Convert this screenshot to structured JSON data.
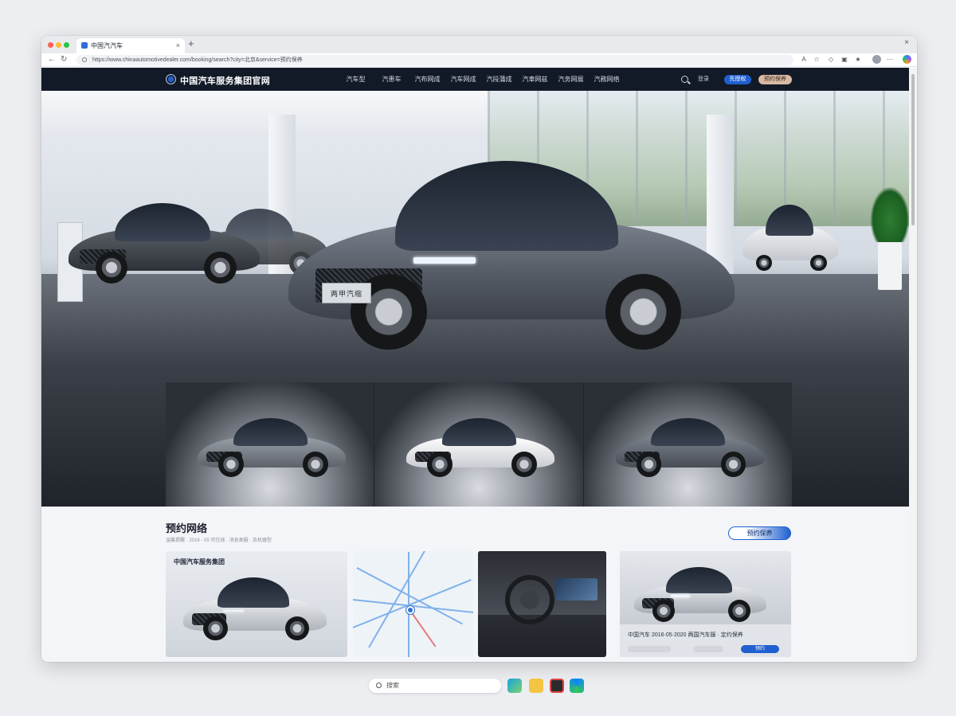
{
  "browser": {
    "tab_title": "中国汽汽车",
    "tab_close": "×",
    "new_tab": "+",
    "window_close": "×",
    "back": "←",
    "reload": "↻",
    "url": "https://www.chinaautomotivedealer.com/booking/search?city=北京&service=预约保养"
  },
  "site": {
    "logo_text": "中国汽车服务集团官网",
    "nav": [
      "汽车型",
      "汽患车",
      "汽布网成",
      "汽车网成",
      "汽段蒲成",
      "汽車网兹",
      "汽务网展",
      "汽務网络"
    ],
    "login": "登录",
    "btn_primary": "先授权",
    "btn_secondary": "预约保养"
  },
  "hero": {
    "plate": "两甲汽缩"
  },
  "section": {
    "title": "预约网络",
    "subtitle": "温馨提醒 · 2016 - 05 可在线 · 消息类服 · 及机器型",
    "book_button": "预约保养"
  },
  "cards": {
    "card1_title": "中国汽车服务集团",
    "card4_info": "中国汽车    2016·05·2020    两国汽车服 · 定约保养",
    "card4_button": "预约"
  },
  "taskbar": {
    "search": "搜索"
  },
  "colors": {
    "brand_blue": "#1f5fd0",
    "header_dark": "#121a28",
    "accent_tan": "#d9b9a3"
  },
  "icons": [
    "search-icon",
    "back-arrow-icon",
    "reload-icon",
    "close-icon",
    "map-pin-icon",
    "steering-wheel-icon"
  ]
}
